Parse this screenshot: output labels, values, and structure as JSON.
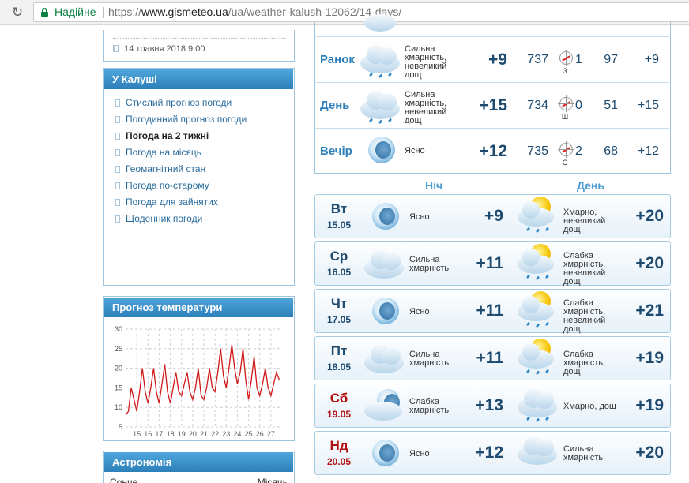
{
  "browser": {
    "secure_label": "Надійне",
    "url_scheme": "https://",
    "url_host": "www.gismeteo.ua",
    "url_path": "/ua/weather-kalush-12062/14-days/"
  },
  "news": {
    "date": "14 травня 2018 9:00"
  },
  "city_menu": {
    "title": "У Калуші",
    "items": [
      {
        "label": "Стислий прогноз погоди",
        "active": false
      },
      {
        "label": "Погодинний прогноз погоди",
        "active": false
      },
      {
        "label": "Погода на 2 тижні",
        "active": true
      },
      {
        "label": "Погода на місяць",
        "active": false
      },
      {
        "label": "Геомагнітний стан",
        "active": false
      },
      {
        "label": "Погода по-старому",
        "active": false
      },
      {
        "label": "Погода для зайнятих",
        "active": false
      },
      {
        "label": "Щоденник погоди",
        "active": false
      }
    ]
  },
  "temp_widget": {
    "title": "Прогноз температури"
  },
  "chart_data": {
    "type": "line",
    "title": "Прогноз температури",
    "xlabel": "",
    "ylabel": "",
    "xlim": [
      14,
      28
    ],
    "ylim": [
      5,
      30
    ],
    "y_ticks": [
      5,
      10,
      15,
      20,
      25,
      30
    ],
    "x_ticks": [
      15,
      16,
      17,
      18,
      19,
      20,
      21,
      22,
      23,
      24,
      25,
      26,
      27
    ],
    "grid": true,
    "color": "#d01818",
    "x": [
      14.0,
      14.25,
      14.5,
      14.75,
      15.0,
      15.25,
      15.5,
      15.75,
      16.0,
      16.25,
      16.5,
      16.75,
      17.0,
      17.25,
      17.5,
      17.75,
      18.0,
      18.25,
      18.5,
      18.75,
      19.0,
      19.25,
      19.5,
      19.75,
      20.0,
      20.25,
      20.5,
      20.75,
      21.0,
      21.25,
      21.5,
      21.75,
      22.0,
      22.25,
      22.5,
      22.75,
      23.0,
      23.25,
      23.5,
      23.75,
      24.0,
      24.25,
      24.5,
      24.75,
      25.0,
      25.25,
      25.5,
      25.75,
      26.0,
      26.25,
      26.5,
      26.75,
      27.0,
      27.25,
      27.5,
      27.75
    ],
    "y": [
      8,
      9,
      15,
      12,
      9,
      14,
      20,
      14,
      11,
      15,
      20,
      14,
      11,
      16,
      21,
      14,
      11,
      15,
      19,
      14,
      13,
      16,
      19,
      14,
      12,
      15,
      20,
      13,
      12,
      15,
      20,
      15,
      14,
      19,
      25,
      18,
      15,
      20,
      26,
      20,
      16,
      19,
      25,
      17,
      12,
      17,
      23,
      15,
      13,
      16,
      20,
      15,
      13,
      16,
      19,
      17
    ]
  },
  "astro_widget": {
    "title": "Астрономія",
    "col_sun": "Сонце",
    "col_moon": "Місяць"
  },
  "today": {
    "parts": [
      {
        "label": "Ранок",
        "icon": "cloudy-light-rain-icon",
        "desc": "Сильна хмарність, невеликий дощ",
        "temp": "+9",
        "pressure": "737",
        "wind": "1",
        "wind_dir": "З",
        "humidity": "97",
        "feels": "+9"
      },
      {
        "label": "День",
        "icon": "cloudy-light-rain-icon",
        "desc": "Сильна хмарність, невеликий дощ",
        "temp": "+15",
        "pressure": "734",
        "wind": "0",
        "wind_dir": "Ш",
        "humidity": "51",
        "feels": "+15"
      },
      {
        "label": "Вечір",
        "icon": "clear-night-icon",
        "desc": "Ясно",
        "temp": "+12",
        "pressure": "735",
        "wind": "2",
        "wind_dir": "С",
        "humidity": "68",
        "feels": "+12"
      }
    ]
  },
  "columns": {
    "night": "Ніч",
    "day": "День"
  },
  "days": [
    {
      "name": "Вт",
      "date": "15.05",
      "weekend": false,
      "night_icon": "clear-night-icon",
      "night_desc": "Ясно",
      "night_temp": "+9",
      "day_icon": "partly-cloudy-rain-icon",
      "day_desc": "Хмарно, невеликий дощ",
      "day_temp": "+20"
    },
    {
      "name": "Ср",
      "date": "16.05",
      "weekend": false,
      "night_icon": "cloudy-icon",
      "night_desc": "Сильна хмарність",
      "night_temp": "+11",
      "day_icon": "partly-cloudy-rain-icon",
      "day_desc": "Слабка хмарність, невеликий дощ",
      "day_temp": "+20"
    },
    {
      "name": "Чт",
      "date": "17.05",
      "weekend": false,
      "night_icon": "clear-night-icon",
      "night_desc": "Ясно",
      "night_temp": "+11",
      "day_icon": "partly-cloudy-rain-icon",
      "day_desc": "Слабка хмарність, невеликий дощ",
      "day_temp": "+21"
    },
    {
      "name": "Пт",
      "date": "18.05",
      "weekend": false,
      "night_icon": "cloudy-icon",
      "night_desc": "Сильна хмарність",
      "night_temp": "+11",
      "day_icon": "partly-cloudy-rain-icon",
      "day_desc": "Слабка хмарність, дощ",
      "day_temp": "+19"
    },
    {
      "name": "Сб",
      "date": "19.05",
      "weekend": true,
      "night_icon": "partly-cloudy-night-icon",
      "night_desc": "Слабка хмарність",
      "night_temp": "+13",
      "day_icon": "cloudy-rain-icon",
      "day_desc": "Хмарно, дощ",
      "day_temp": "+19"
    },
    {
      "name": "Нд",
      "date": "20.05",
      "weekend": true,
      "night_icon": "clear-night-icon",
      "night_desc": "Ясно",
      "night_temp": "+12",
      "day_icon": "cloudy-icon",
      "day_desc": "Сильна хмарність",
      "day_temp": "+20"
    }
  ]
}
